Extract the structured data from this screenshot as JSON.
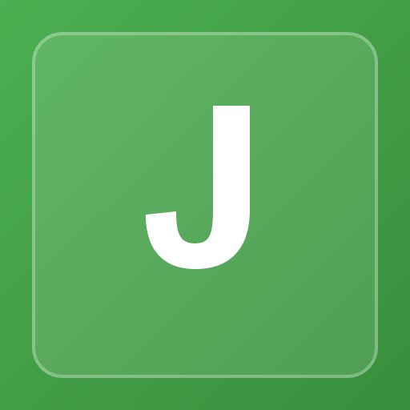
{
  "icon": {
    "letter": "J",
    "name": "j-letter-icon"
  },
  "colors": {
    "background_start": "#4caf50",
    "background_end": "#388e3c",
    "letter": "#ffffff"
  }
}
